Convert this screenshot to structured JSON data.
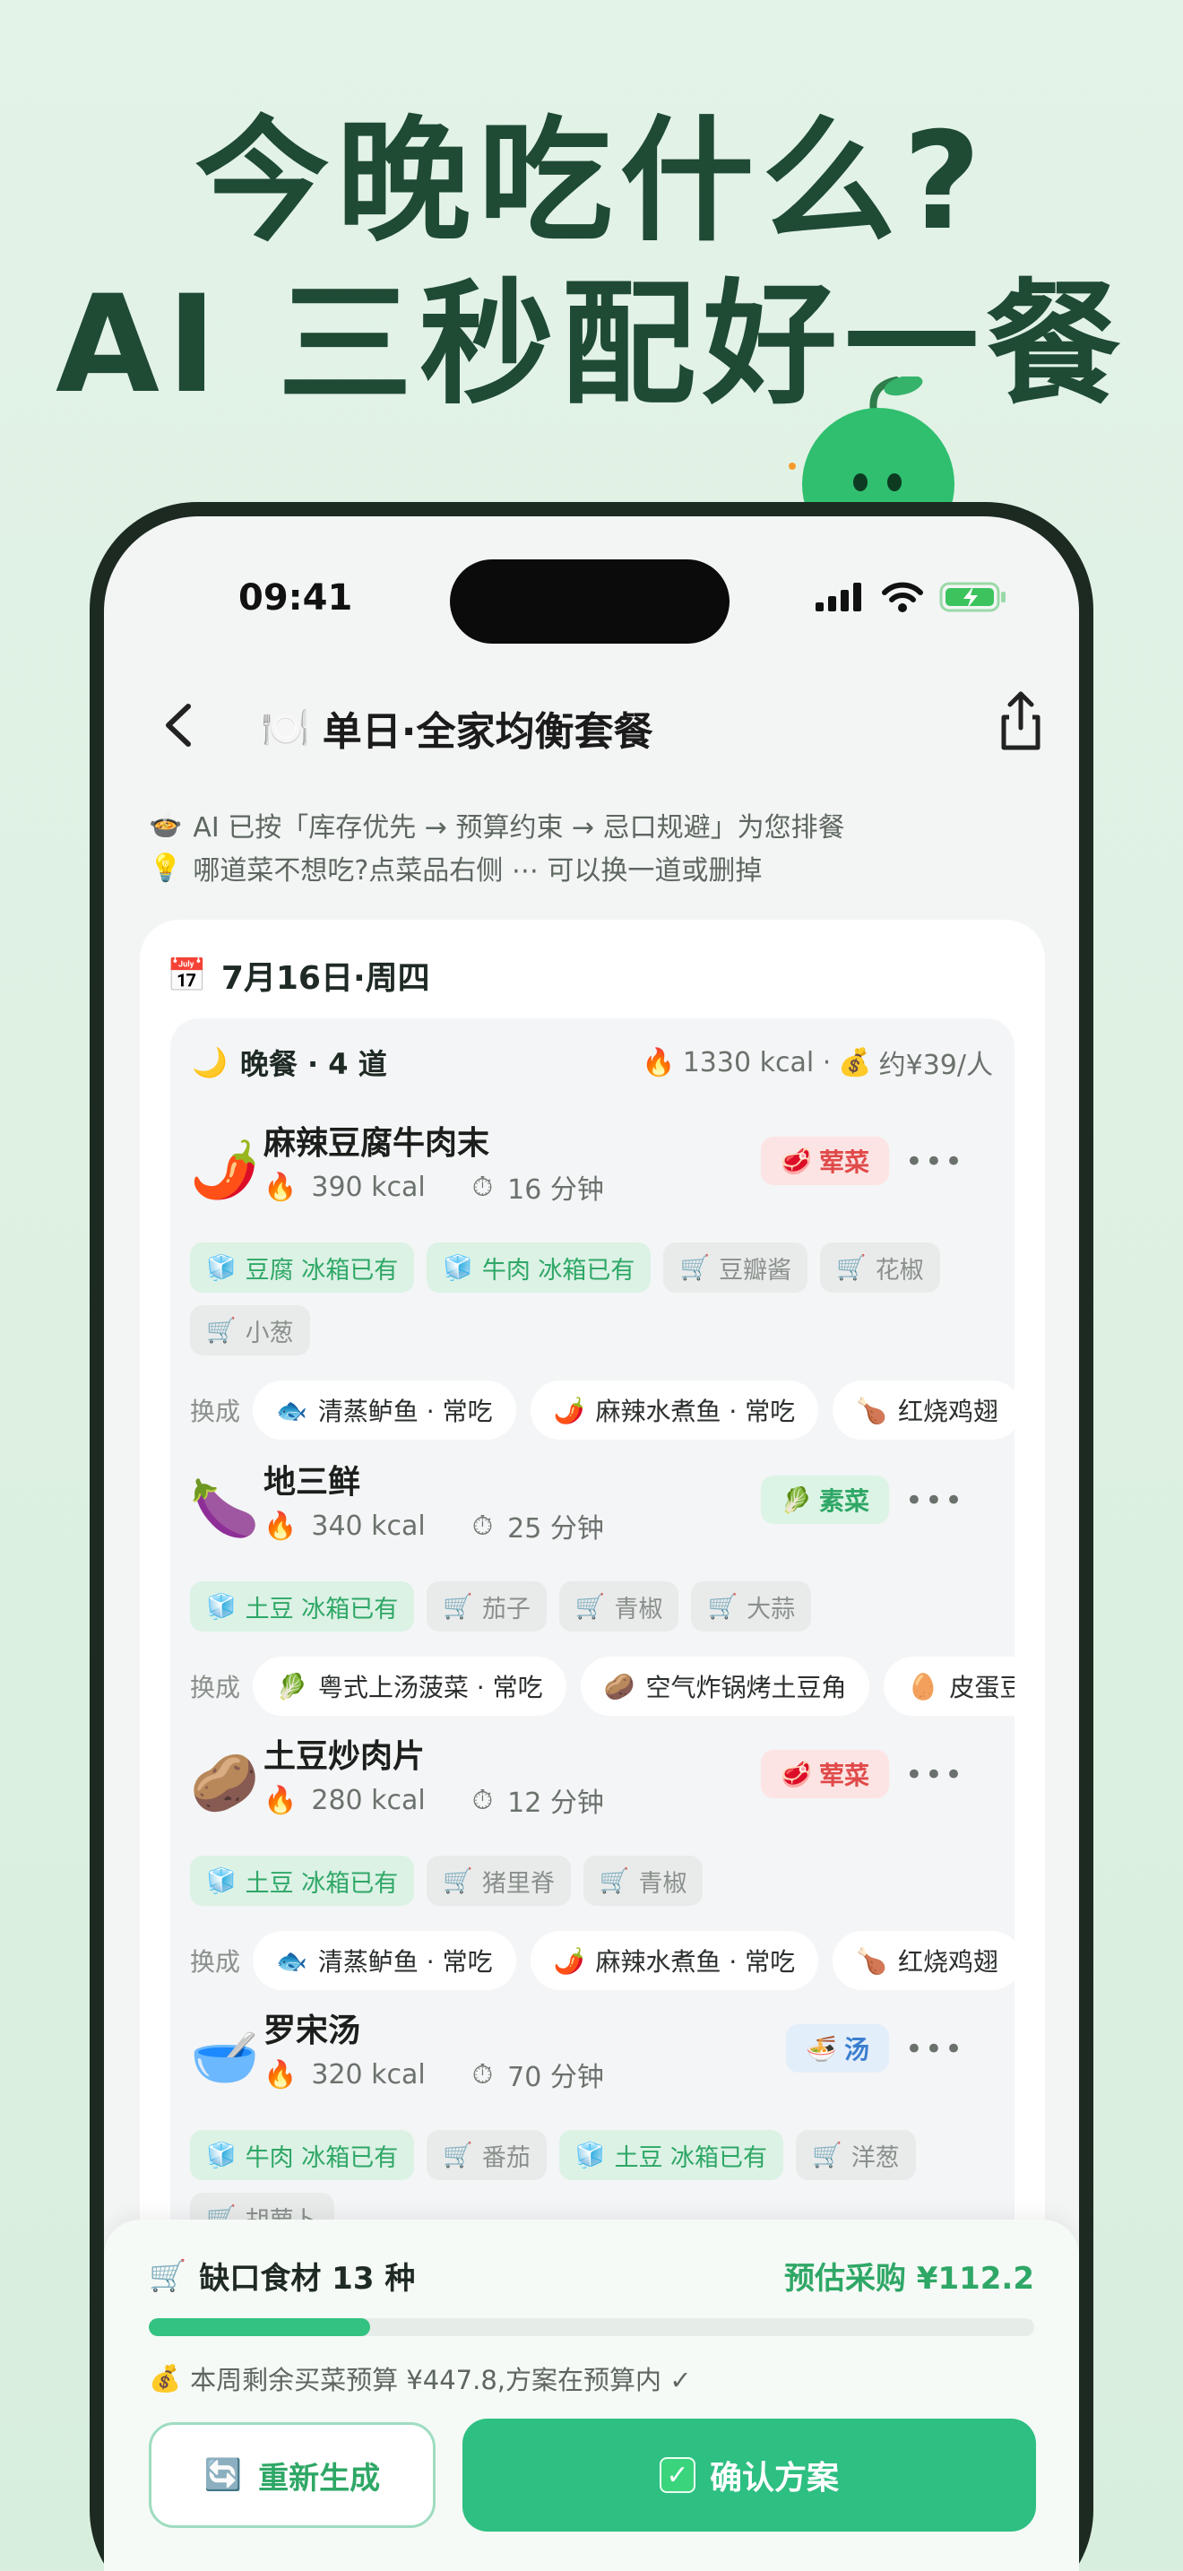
{
  "headline": {
    "line1": "今晚吃什么?",
    "line2": "AI 三秒配好一餐"
  },
  "status": {
    "time": "09:41"
  },
  "nav": {
    "title": "单日·全家均衡套餐",
    "title_icon": "🍽️"
  },
  "tips": [
    {
      "icon": "🍲",
      "text": "AI 已按「库存优先 → 预算约束 → 忌口规避」为您排餐"
    },
    {
      "icon": "💡",
      "text": "哪道菜不想吃?点菜品右侧 ⋯ 可以换一道或删掉"
    }
  ],
  "day": {
    "icon": "📅",
    "label": "7月16日·周四"
  },
  "meal": {
    "icon": "🌙",
    "name": "晚餐 · 4 道",
    "summary_kcal_icon": "🔥",
    "summary_kcal": "1330 kcal ·",
    "summary_cost_icon": "💰",
    "summary_cost": "约¥39/人"
  },
  "swap_label": "换成",
  "dishes": [
    {
      "emoji": "🌶️",
      "name": "麻辣豆腐牛肉末",
      "kcal": "390 kcal",
      "time": "16 分钟",
      "category": "荤菜",
      "category_icon": "🥩",
      "chips": [
        {
          "type": "have",
          "icon": "🧊",
          "label": "豆腐 冰箱已有"
        },
        {
          "type": "have",
          "icon": "🧊",
          "label": "牛肉 冰箱已有"
        },
        {
          "type": "buy",
          "icon": "🛒",
          "label": "豆瓣酱"
        },
        {
          "type": "buy",
          "icon": "🛒",
          "label": "花椒"
        },
        {
          "type": "buy",
          "icon": "🛒",
          "label": "小葱"
        }
      ],
      "swaps": [
        {
          "icon": "🐟",
          "label": "清蒸鲈鱼 · 常吃"
        },
        {
          "icon": "🌶️",
          "label": "麻辣水煮鱼 · 常吃"
        },
        {
          "icon": "🍗",
          "label": "红烧鸡翅"
        }
      ]
    },
    {
      "emoji": "🍆",
      "name": "地三鲜",
      "kcal": "340 kcal",
      "time": "25 分钟",
      "category": "素菜",
      "category_icon": "🥬",
      "chips": [
        {
          "type": "have",
          "icon": "🧊",
          "label": "土豆 冰箱已有"
        },
        {
          "type": "buy",
          "icon": "🛒",
          "label": "茄子"
        },
        {
          "type": "buy",
          "icon": "🛒",
          "label": "青椒"
        },
        {
          "type": "buy",
          "icon": "🛒",
          "label": "大蒜"
        }
      ],
      "swaps": [
        {
          "icon": "🥬",
          "label": "粤式上汤菠菜 · 常吃"
        },
        {
          "icon": "🥔",
          "label": "空气炸锅烤土豆角"
        },
        {
          "icon": "🥚",
          "label": "皮蛋豆腐"
        }
      ]
    },
    {
      "emoji": "🥔",
      "name": "土豆炒肉片",
      "kcal": "280 kcal",
      "time": "12 分钟",
      "category": "荤菜",
      "category_icon": "🥩",
      "chips": [
        {
          "type": "have",
          "icon": "🧊",
          "label": "土豆 冰箱已有"
        },
        {
          "type": "buy",
          "icon": "🛒",
          "label": "猪里脊"
        },
        {
          "type": "buy",
          "icon": "🛒",
          "label": "青椒"
        }
      ],
      "swaps": [
        {
          "icon": "🐟",
          "label": "清蒸鲈鱼 · 常吃"
        },
        {
          "icon": "🌶️",
          "label": "麻辣水煮鱼 · 常吃"
        },
        {
          "icon": "🍗",
          "label": "红烧鸡翅"
        }
      ]
    },
    {
      "emoji": "🥣",
      "name": "罗宋汤",
      "kcal": "320 kcal",
      "time": "70 分钟",
      "category": "汤",
      "category_icon": "🍜",
      "chips": [
        {
          "type": "have",
          "icon": "🧊",
          "label": "牛肉 冰箱已有"
        },
        {
          "type": "buy",
          "icon": "🛒",
          "label": "番茄"
        },
        {
          "type": "have",
          "icon": "🧊",
          "label": "土豆 冰箱已有"
        },
        {
          "type": "buy",
          "icon": "🛒",
          "label": "洋葱"
        },
        {
          "type": "buy",
          "icon": "🛒",
          "label": "胡萝卜"
        }
      ],
      "swaps": []
    }
  ],
  "sheet": {
    "missing_icon": "🛒",
    "missing": "缺口食材 13 种",
    "estimate": "预估采购 ¥112.2",
    "budget_progress": 0.25,
    "budget_icon": "💰",
    "budget": "本周剩余买菜预算 ¥447.8,方案在预算内 ✓",
    "regen_label": "重新生成",
    "regen_icon": "🔄",
    "confirm_label": "确认方案",
    "confirm_icon": "✓"
  },
  "colors": {
    "accent": "#2ebf82",
    "headline": "#1f4a33",
    "meat": "#e04a4a",
    "veg": "#2fa766",
    "soup": "#3b7fcf"
  }
}
